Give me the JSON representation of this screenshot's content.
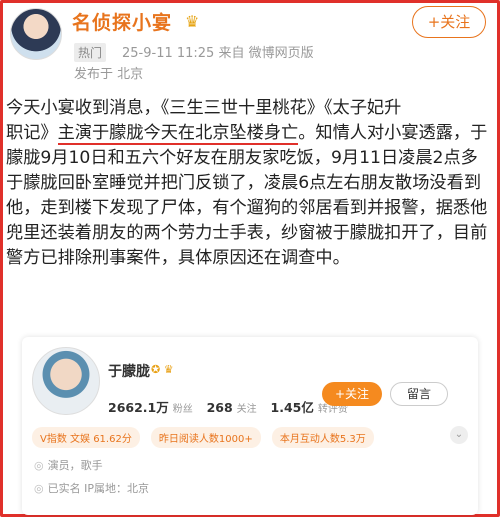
{
  "post": {
    "username": "名侦探小宴",
    "badge_icon": "crown-icon",
    "hot_tag": "热门",
    "meta": "25-9-11 11:25  来自 微博网页版",
    "location": "发布于 北京",
    "follow_label": "+关注"
  },
  "body": {
    "line1": "今天小宴收到消息，《三生三世十里桃花》《太子妃升",
    "line2a": "职记》",
    "line2b": "主演于朦胧今天在北京坠楼身亡",
    "line2c": "。知情人对小宴",
    "rest": "透露，于朦胧9月10日和五六个好友在朋友家吃饭，9月11日凌晨2点多于朦胧回卧室睡觉并把门反锁了，凌晨6点左右朋友散场没看到他，走到楼下发现了尸体，有个遛狗的邻居看到并报警，据悉他兜里还装着朋友的两个劳力士手表，纱窗被于朦胧扣开了，目前警方已排除刑事案件，具体原因还在调查中。"
  },
  "card": {
    "name": "于朦胧",
    "fans_value": "2662.1万",
    "fans_label": "粉丝",
    "follow_value": "268",
    "follow_label": "关注",
    "likes_value": "1.45亿",
    "likes_label": "转评赞",
    "follow_btn": "+关注",
    "message_btn": "留言",
    "pills": [
      "V指数 文娱 61.62分",
      "昨日阅读人数1000+",
      "本月互动人数5.3万"
    ],
    "info1": "演员，歌手",
    "info2": "已实名   IP属地：北京"
  },
  "colors": {
    "accent": "#e8741d",
    "frame": "#e0302a"
  }
}
